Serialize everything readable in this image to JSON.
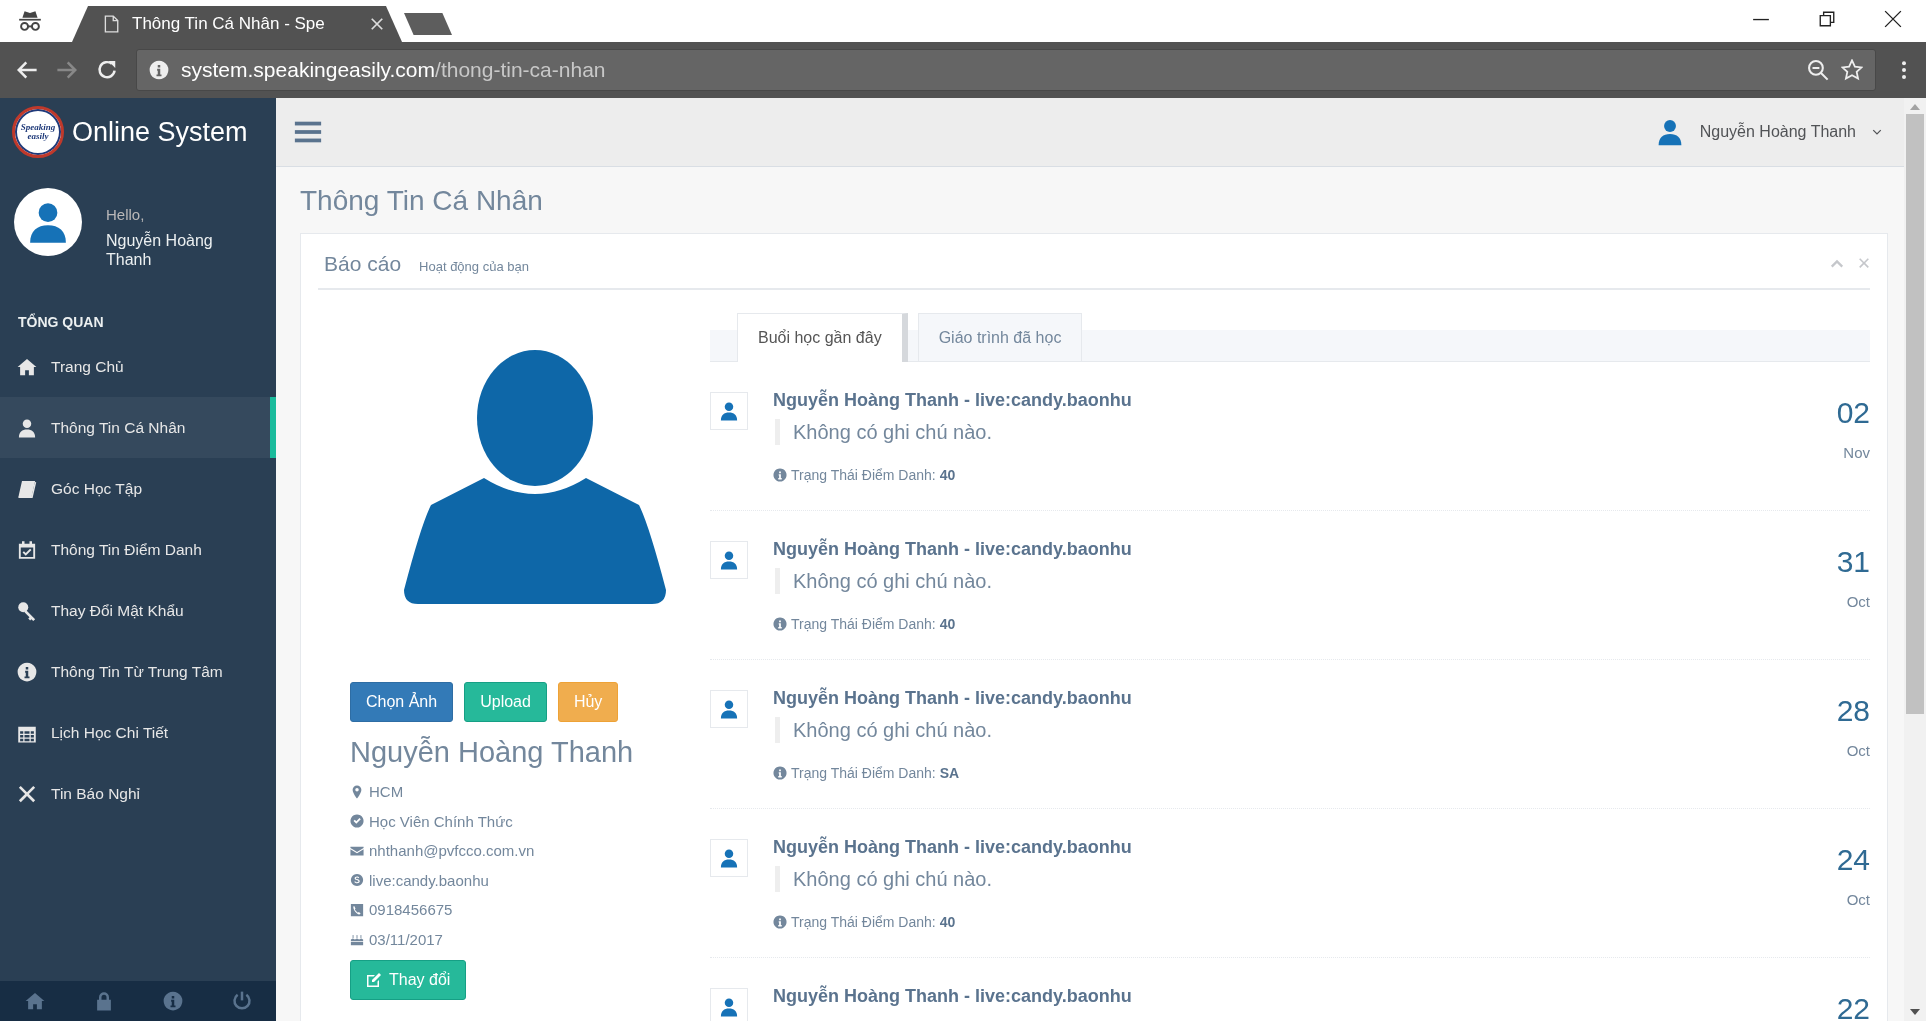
{
  "browser": {
    "tab_title": "Thông Tin Cá Nhân - Spe",
    "url_host": "system.speakingeasily.com",
    "url_path": "/thong-tin-ca-nhan"
  },
  "sidebar": {
    "logo_text": "Speaking easily",
    "brand": "Online System",
    "greeting": "Hello,",
    "user_name": "Nguyễn Hoàng Thanh",
    "section": "TỔNG QUAN",
    "items": [
      {
        "label": "Trang Chủ",
        "selected": false
      },
      {
        "label": "Thông Tin Cá Nhân",
        "selected": true
      },
      {
        "label": "Góc Học Tập",
        "selected": false
      },
      {
        "label": "Thông Tin Điểm Danh",
        "selected": false
      },
      {
        "label": "Thay Đổi Mật Khẩu",
        "selected": false
      },
      {
        "label": "Thông Tin Từ Trung Tâm",
        "selected": false
      },
      {
        "label": "Lịch Học Chi Tiết",
        "selected": false
      },
      {
        "label": "Tin Báo Nghỉ",
        "selected": false
      }
    ]
  },
  "top_nav": {
    "user_name": "Nguyễn Hoàng Thanh"
  },
  "page_title": "Thông Tin Cá Nhân",
  "panel": {
    "title": "Báo cáo",
    "subtitle": "Hoạt động của bạn",
    "profile": {
      "buttons": [
        {
          "label": "Chọn Ảnh",
          "kind": "primary"
        },
        {
          "label": "Upload",
          "kind": "success"
        },
        {
          "label": "Hủy",
          "kind": "warning"
        }
      ],
      "name": "Nguyễn Hoàng Thanh",
      "details": [
        {
          "text": "HCM"
        },
        {
          "text": "Học Viên Chính Thức"
        },
        {
          "text": "nhthanh@pvfcco.com.vn"
        },
        {
          "text": "live:candy.baonhu"
        },
        {
          "text": "0918456675"
        },
        {
          "text": "03/11/2017"
        }
      ],
      "edit_button": "Thay đổi"
    },
    "tabs": [
      {
        "label": "Buổi học gần đây",
        "selected": true
      },
      {
        "label": "Giáo trình đã học",
        "selected": false
      }
    ],
    "activities": [
      {
        "title": "Nguyễn Hoàng Thanh - live:candy.baonhu",
        "note": "Không có ghi chú nào.",
        "status": "Trạng Thái Điểm Danh: **40**",
        "day": "02",
        "month": "Nov"
      },
      {
        "title": "Nguyễn Hoàng Thanh - live:candy.baonhu",
        "note": "Không có ghi chú nào.",
        "status": "Trạng Thái Điểm Danh: **40**",
        "day": "31",
        "month": "Oct"
      },
      {
        "title": "Nguyễn Hoàng Thanh - live:candy.baonhu",
        "note": "Không có ghi chú nào.",
        "status": "Trạng Thái Điểm Danh: **SA**",
        "day": "28",
        "month": "Oct"
      },
      {
        "title": "Nguyễn Hoàng Thanh - live:candy.baonhu",
        "note": "Không có ghi chú nào.",
        "status": "Trạng Thái Điểm Danh: **40**",
        "day": "24",
        "month": "Oct"
      },
      {
        "title": "Nguyễn Hoàng Thanh - live:candy.baonhu",
        "day": "22"
      }
    ]
  }
}
